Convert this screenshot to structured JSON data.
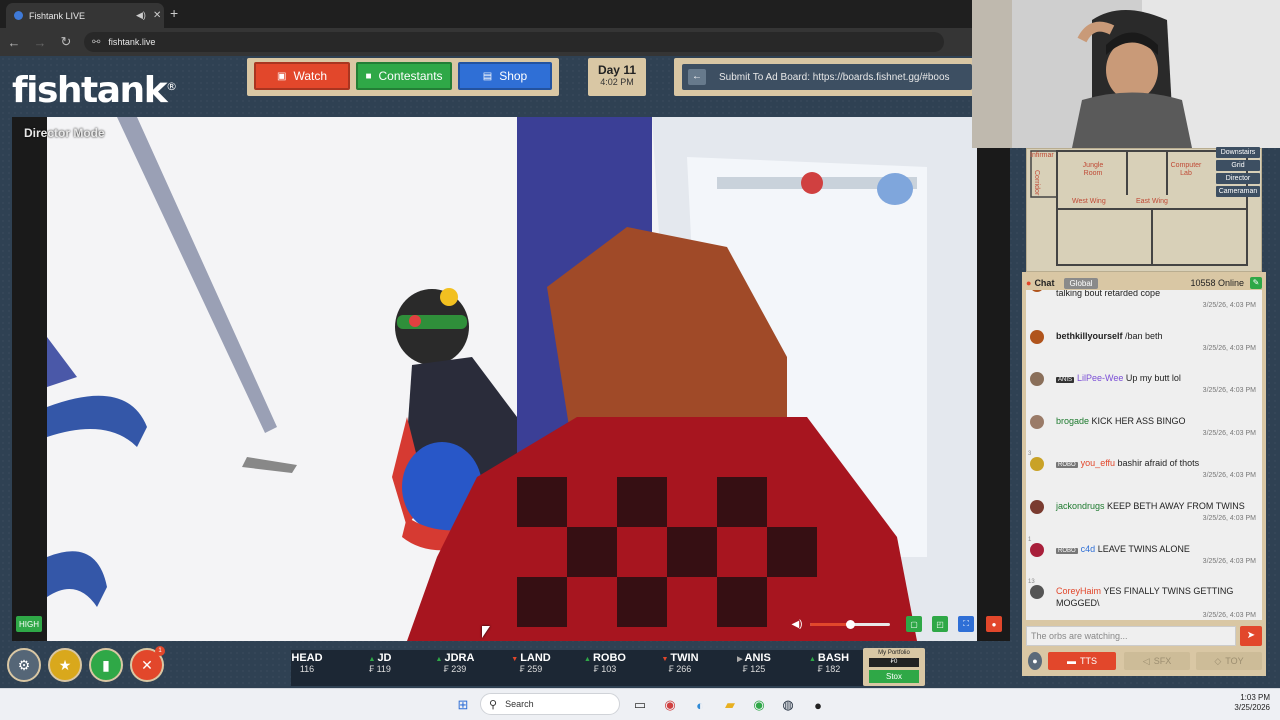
{
  "browser": {
    "tab_title": "Fishtank LIVE",
    "url": "fishtank.live",
    "back_icon": "arrow-left",
    "forward_icon": "arrow-right",
    "reload_icon": "reload"
  },
  "site": {
    "logo": "fishtank",
    "logo_mark": "®",
    "nav": [
      {
        "label": "Watch",
        "icon": "tv-icon",
        "color": "#e2472b"
      },
      {
        "label": "Contestants",
        "icon": "person-icon",
        "color": "#2fa847"
      },
      {
        "label": "Shop",
        "icon": "cart-icon",
        "color": "#2f6fd6"
      }
    ],
    "day": "Day 11",
    "time": "4:02 PM",
    "adboard_text": "Submit To Ad Board: https://boards.fishnet.gg/#boos"
  },
  "video": {
    "mode_label": "Director Mode",
    "quality_badge": "HIGH",
    "volume_level": 0.5
  },
  "map": {
    "rooms": [
      "Infirmar",
      "Jungle Room",
      "Computer Lab",
      "Corridor",
      "West Wing",
      "East Wing"
    ],
    "buttons": [
      "Downstairs",
      "Grid",
      "Director",
      "Cameraman"
    ]
  },
  "chat": {
    "title": "Chat",
    "scope": "Global",
    "online": "10558 Online",
    "messages": [
      {
        "user": "",
        "text": "talking bout retarded cope",
        "time": "3/25/26, 4:03 PM",
        "user_color": "#222",
        "badge": "",
        "av": "#b0541c"
      },
      {
        "user": "bethkillyourself",
        "text": "/ban beth",
        "time": "3/25/26, 4:03 PM",
        "user_color": "#222",
        "badge": "",
        "av": "#b0541c"
      },
      {
        "user": "LilPee-Wee",
        "text": "Up my butt lol",
        "time": "3/25/26, 4:03 PM",
        "user_color": "#7b4fd6",
        "badge": "ANIS",
        "badge_color": "#333",
        "av": "#8a6f5a"
      },
      {
        "user": "brogade",
        "text": "KICK HER ASS BINGO",
        "time": "3/25/26, 4:03 PM",
        "user_color": "#1d7a2e",
        "badge": "",
        "av": "#9a7b68"
      },
      {
        "user": "you_effu",
        "text": "bashir afraid of thots",
        "time": "3/25/26, 4:03 PM",
        "user_color": "#e2472b",
        "badge": "ROBO",
        "badge_color": "#777",
        "av": "#c9a227",
        "num": "3"
      },
      {
        "user": "jackondrugs",
        "text": "KEEP BETH AWAY FROM TWINS",
        "time": "3/25/26, 4:03 PM",
        "user_color": "#1d7a2e",
        "badge": "",
        "av": "#7a3b30"
      },
      {
        "user": "c4d",
        "text": "LEAVE TWINS ALONE",
        "time": "3/25/26, 4:03 PM",
        "user_color": "#2f6fd6",
        "badge": "ROBO",
        "badge_color": "#777",
        "av": "#a81f3a",
        "num": "1"
      },
      {
        "user": "CoreyHaim",
        "text": "YES FINALLY TWINS GETTING MOGGED\\",
        "time": "3/25/26, 4:03 PM",
        "user_color": "#e2472b",
        "badge": "",
        "av": "#555",
        "num": "13"
      }
    ],
    "input_placeholder": "The orbs are watching...",
    "send_icon": "send-icon",
    "buttons": [
      "TTS",
      "SFX",
      "TOY"
    ]
  },
  "tools": [
    {
      "name": "settings-icon",
      "glyph": "⚙",
      "color": "#556677"
    },
    {
      "name": "bolt-icon",
      "glyph": "★",
      "color": "#d9a81c"
    },
    {
      "name": "clipboard-icon",
      "glyph": "▮",
      "color": "#2fa847"
    },
    {
      "name": "tools-icon",
      "glyph": "✕",
      "color": "#e2472b",
      "badge": "1"
    }
  ],
  "ticker": [
    {
      "name": "HEAD",
      "price": "116",
      "dir": ""
    },
    {
      "name": "JD",
      "price": "119",
      "dir": "up"
    },
    {
      "name": "JDRA",
      "price": "239",
      "dir": "up"
    },
    {
      "name": "LAND",
      "price": "259",
      "dir": "down"
    },
    {
      "name": "ROBO",
      "price": "103",
      "dir": "up"
    },
    {
      "name": "TWIN",
      "price": "266",
      "dir": "down"
    },
    {
      "name": "ANIS",
      "price": "125",
      "dir": "flat"
    },
    {
      "name": "BASH",
      "price": "182",
      "dir": "up"
    }
  ],
  "portfolio": {
    "label": "My Portfolio",
    "value": "₣0",
    "button": "Stox"
  },
  "taskbar": {
    "search": "Search",
    "time": "1:03 PM",
    "date": "3/25/2026"
  }
}
